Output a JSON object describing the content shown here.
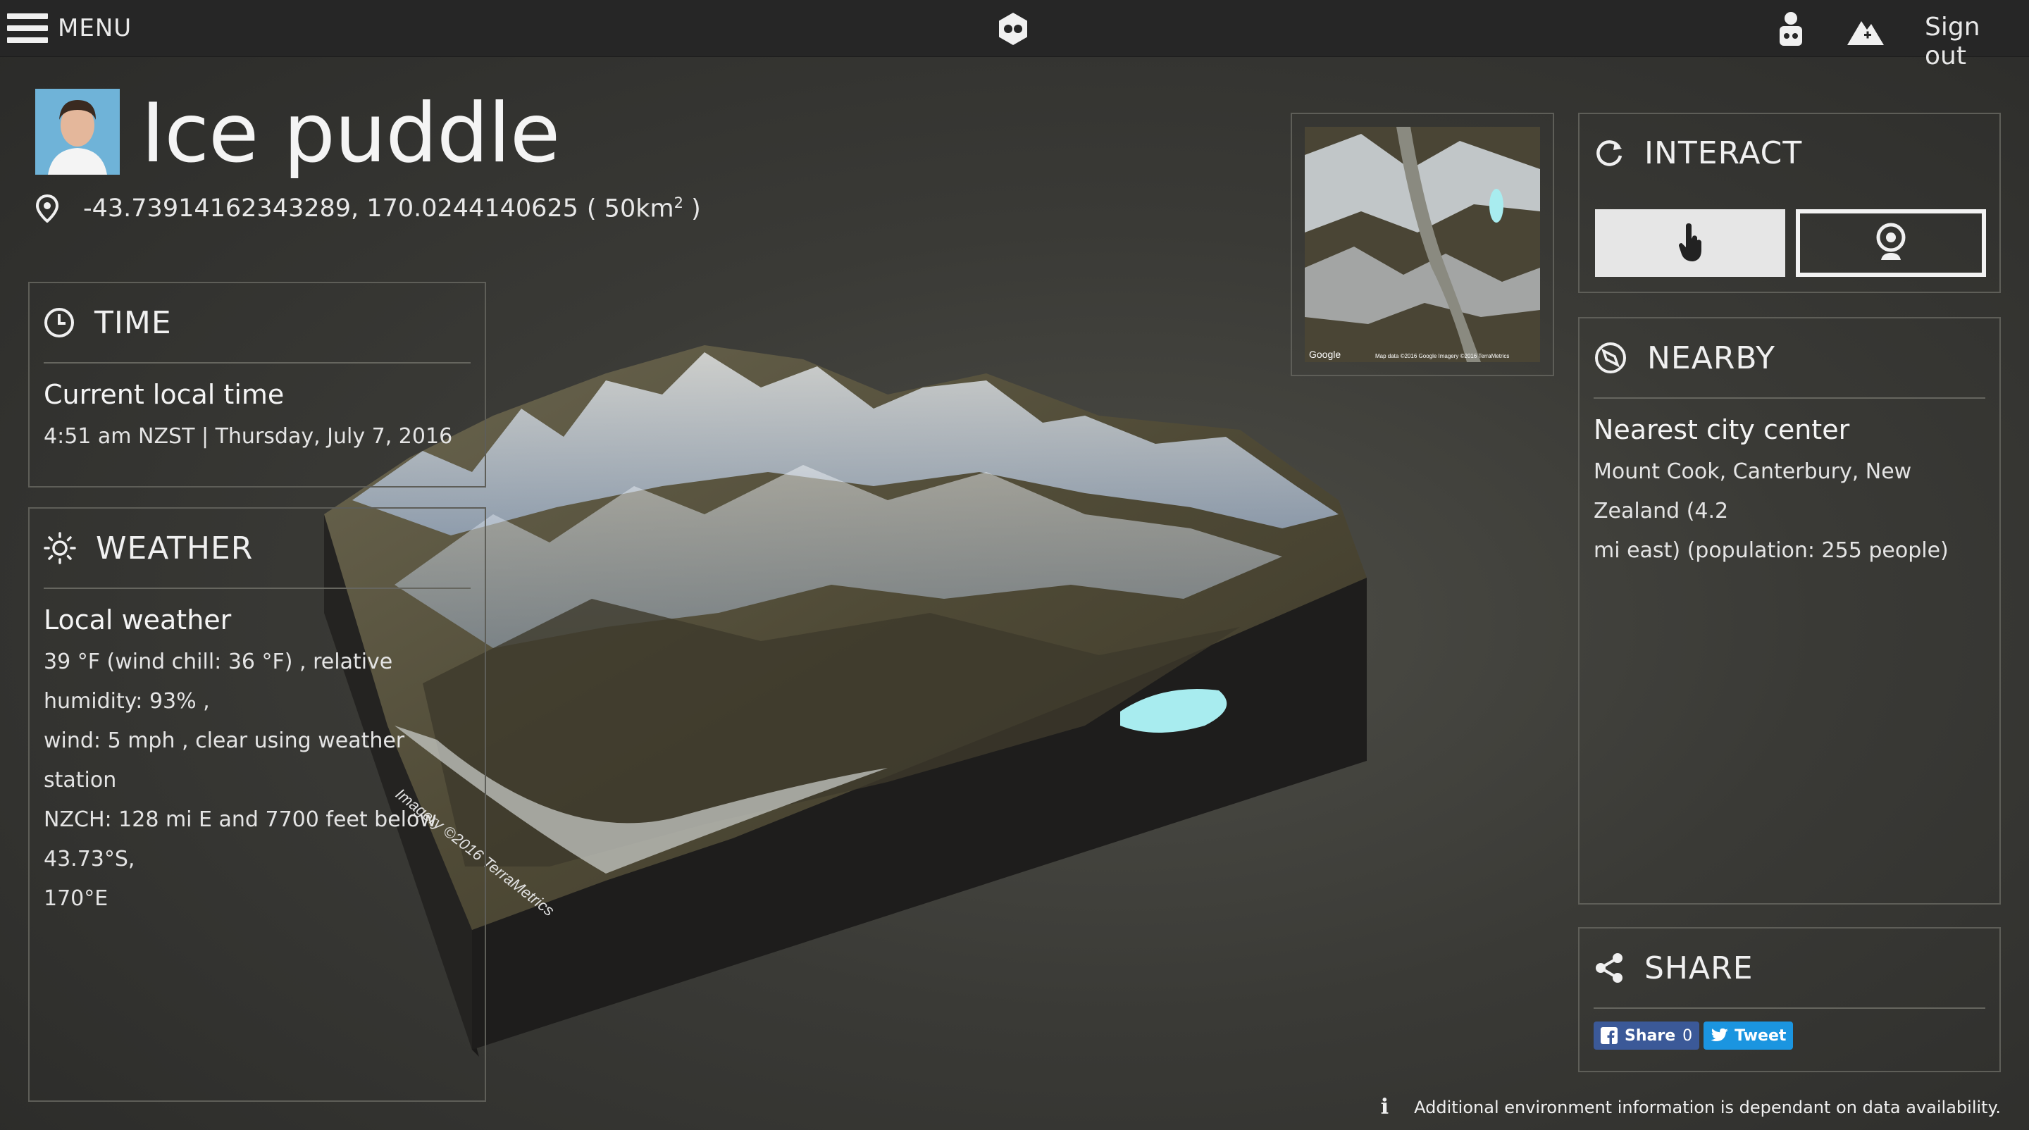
{
  "topbar": {
    "menu_label": "MENU",
    "signout_label": "Sign out",
    "logo_icon": "terrain-logo-icon",
    "user_icon": "user-icon",
    "add_terrain_icon": "mountain-add-icon"
  },
  "header": {
    "title": "Ice puddle",
    "coordinates": "-43.73914162343289, 170.0244140625",
    "area_prefix": "( 50km",
    "area_exponent": "2",
    "area_suffix": " )"
  },
  "time": {
    "heading": "TIME",
    "subheading": "Current local time",
    "value": "4:51 am NZST | Thursday, July 7, 2016"
  },
  "weather": {
    "heading": "WEATHER",
    "subheading": "Local weather",
    "lines": [
      "39 °F (wind chill: 36 °F) , relative humidity: 93% ,",
      "wind: 5 mph , clear using weather station",
      "NZCH: 128 mi E and 7700 feet below 43.73°S,",
      "170°E"
    ]
  },
  "interact": {
    "heading": "INTERACT",
    "touch_icon": "hand-pointer-icon",
    "camera_icon": "webcam-icon"
  },
  "nearby": {
    "heading": "NEARBY",
    "subheading": "Nearest city center",
    "lines": [
      "Mount Cook, Canterbury, New Zealand (4.2",
      "mi east) (population: 255 people)"
    ]
  },
  "share": {
    "heading": "SHARE",
    "facebook_label": "Share",
    "facebook_count": "0",
    "twitter_label": "Tweet"
  },
  "minimap": {
    "google_label": "Google",
    "attribution": "Map data ©2016 Google  Imagery ©2016 TerraMetrics"
  },
  "terrain": {
    "attribution": "Imagery ©2016 TerraMetrics"
  },
  "footer": {
    "info_icon": "info-icon",
    "note": "Additional environment information is dependant on data availability."
  },
  "colors": {
    "topbar": "#262626",
    "panel_border": "#5e5e58",
    "facebook": "#3b5998",
    "twitter": "#1b95e0"
  }
}
